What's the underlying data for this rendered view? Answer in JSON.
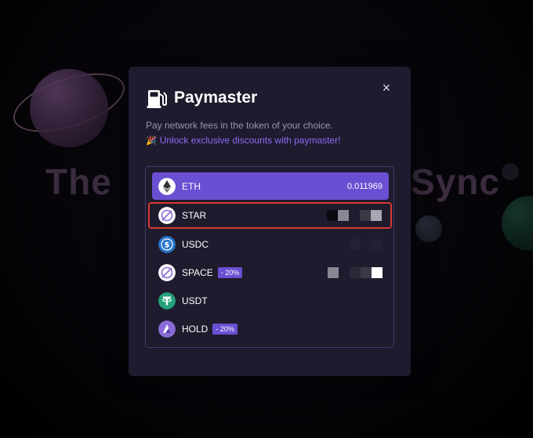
{
  "background": {
    "headline_left": "The",
    "headline_right": "Sync"
  },
  "modal": {
    "title": "Paymaster",
    "subtitle": "Pay network fees in the token of your choice.",
    "promo_text": "Unlock exclusive discounts with paymaster!",
    "close_label": "×"
  },
  "tokens": [
    {
      "name": "ETH",
      "balance": "0.011969",
      "state": "selected",
      "icon": "eth-icon"
    },
    {
      "name": "STAR",
      "state": "highlighted",
      "icon": "star-token-icon"
    },
    {
      "name": "USDC",
      "icon": "usdc-icon"
    },
    {
      "name": "SPACE",
      "badge": "- 20%",
      "icon": "space-token-icon"
    },
    {
      "name": "USDT",
      "icon": "usdt-icon"
    },
    {
      "name": "HOLD",
      "badge": "- 20%",
      "icon": "hold-token-icon"
    }
  ],
  "colors": {
    "accent": "#6a4fd2",
    "highlight_border": "#d8382f",
    "modal_bg": "#1e1b2e",
    "promo_text": "#8f6bf7"
  }
}
